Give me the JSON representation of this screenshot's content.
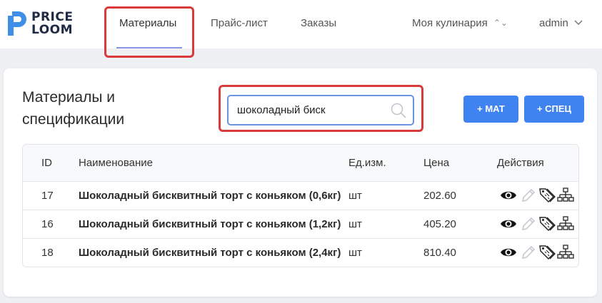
{
  "brand": {
    "line1": "PRICE",
    "line2": "LOOM",
    "mark_color": "#3f8ee8"
  },
  "nav": {
    "items": [
      {
        "label": "Материалы",
        "active": true
      },
      {
        "label": "Прайс-лист"
      },
      {
        "label": "Заказы"
      }
    ]
  },
  "top_right": {
    "workspace": "Моя кулинария",
    "user": "admin"
  },
  "page": {
    "title": "Материалы и спецификации"
  },
  "search": {
    "value": "шоколадный биск",
    "placeholder": ""
  },
  "buttons": {
    "add_material": "+ МАТ",
    "add_spec": "+ СПЕЦ"
  },
  "table": {
    "columns": [
      "ID",
      "Наименование",
      "Ед.изм.",
      "Цена",
      "Действия"
    ],
    "rows": [
      {
        "id": "17",
        "name": "Шоколадный бисквитный торт с коньяком (0,6кг)",
        "unit": "шт",
        "price": "202.60"
      },
      {
        "id": "16",
        "name": "Шоколадный бисквитный торт с коньяком (1,2кг)",
        "unit": "шт",
        "price": "405.20"
      },
      {
        "id": "18",
        "name": "Шоколадный бисквитный торт с коньяком (2,4кг)",
        "unit": "шт",
        "price": "810.40"
      }
    ],
    "action_icons": [
      "eye-icon",
      "pencil-icon",
      "price-tags-icon",
      "hierarchy-icon"
    ]
  },
  "colors": {
    "accent": "#3f83f0",
    "highlight": "#d93a3a",
    "nav_underline": "#8b95e6"
  }
}
